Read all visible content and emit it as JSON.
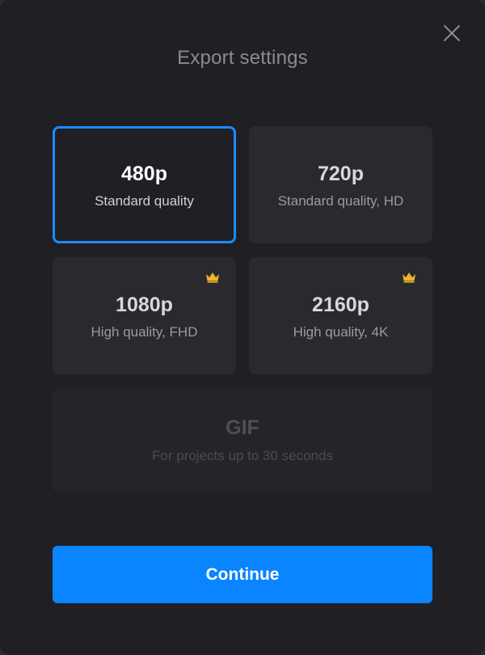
{
  "dialog": {
    "title": "Export settings",
    "close_icon": "close-icon"
  },
  "options": [
    {
      "label": "480p",
      "description": "Standard quality",
      "selected": true,
      "premium": false,
      "disabled": false
    },
    {
      "label": "720p",
      "description": "Standard quality, HD",
      "selected": false,
      "premium": false,
      "disabled": false
    },
    {
      "label": "1080p",
      "description": "High quality, FHD",
      "selected": false,
      "premium": true,
      "disabled": false
    },
    {
      "label": "2160p",
      "description": "High quality, 4K",
      "selected": false,
      "premium": true,
      "disabled": false
    },
    {
      "label": "GIF",
      "description": "For projects up to 30 seconds",
      "selected": false,
      "premium": false,
      "disabled": true
    }
  ],
  "premium_icon": "crown-icon",
  "footer": {
    "continue_label": "Continue"
  },
  "colors": {
    "accent": "#0a84ff",
    "selected_border": "#1a8cff",
    "crown": "#f0b429",
    "background": "#1f1f24",
    "card": "#29292e"
  }
}
